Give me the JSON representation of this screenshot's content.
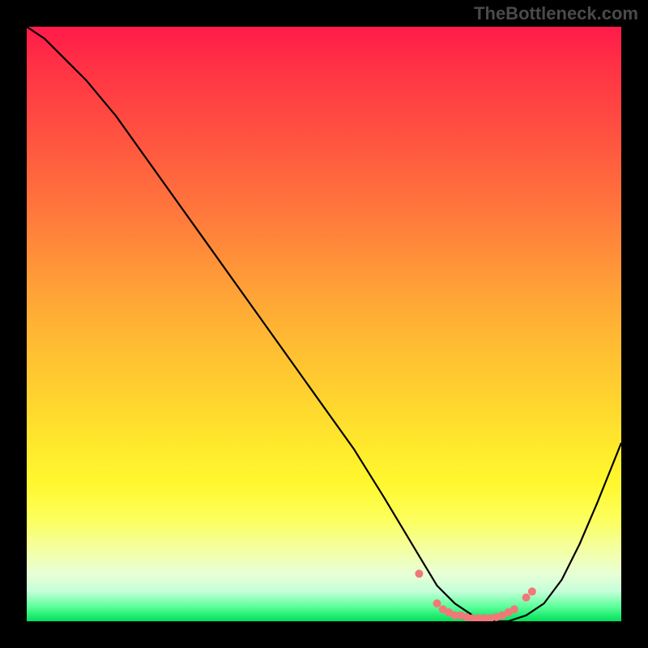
{
  "watermark": "TheBottleneck.com",
  "chart_data": {
    "type": "line",
    "title": "",
    "xlabel": "",
    "ylabel": "",
    "xlim": [
      0,
      100
    ],
    "ylim": [
      0,
      100
    ],
    "grid": false,
    "legend": false,
    "series": [
      {
        "name": "bottleneck-curve",
        "color": "#000000",
        "x": [
          0,
          3,
          6,
          10,
          15,
          20,
          25,
          30,
          35,
          40,
          45,
          50,
          55,
          60,
          63,
          66,
          69,
          72,
          75,
          78,
          81,
          84,
          87,
          90,
          93,
          96,
          100
        ],
        "y": [
          100,
          98,
          95,
          91,
          85,
          78,
          71,
          64,
          57,
          50,
          43,
          36,
          29,
          21,
          16,
          11,
          6,
          3,
          1,
          0,
          0,
          1,
          3,
          7,
          13,
          20,
          30
        ]
      },
      {
        "name": "optimal-range-dots",
        "color": "#f07878",
        "type": "scatter",
        "x": [
          66,
          69,
          70,
          71,
          72,
          73,
          74,
          75,
          76,
          77,
          78,
          79,
          80,
          81,
          82,
          84,
          85
        ],
        "y": [
          8,
          3,
          2,
          1.5,
          1,
          1,
          0.7,
          0.5,
          0.5,
          0.5,
          0.5,
          0.7,
          1,
          1.5,
          2,
          4,
          5
        ]
      }
    ],
    "background_gradient": {
      "top": "#ff1a4a",
      "mid": "#ffe82c",
      "bottom": "#00e05a"
    }
  }
}
